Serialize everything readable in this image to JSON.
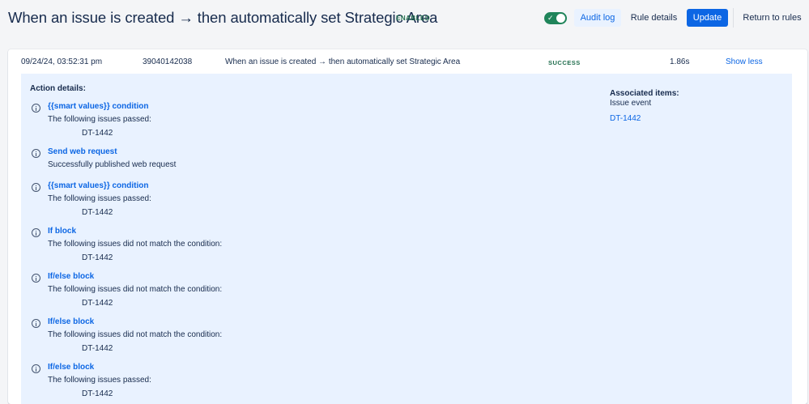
{
  "header": {
    "title": "When an issue is created → then automatically set Strategic Area",
    "status_badge": "ENABLED",
    "toggle_check": "✓",
    "audit_log_label": "Audit log",
    "rule_details_label": "Rule details",
    "update_label": "Update",
    "return_label": "Return to rules"
  },
  "log_entry": {
    "timestamp": "09/24/24, 03:52:31 pm",
    "id": "39040142038",
    "rule_name": "When an issue is created → then automatically set Strategic Area",
    "status": "SUCCESS",
    "duration": "1.86s",
    "show_less_label": "Show less"
  },
  "details": {
    "heading": "Action details:",
    "actions": [
      {
        "title": "{{smart values}} condition",
        "description": "The following issues passed:",
        "issue": "DT-1442"
      },
      {
        "title": "Send web request",
        "description": "Successfully published web request",
        "issue": ""
      },
      {
        "title": "{{smart values}} condition",
        "description": "The following issues passed:",
        "issue": "DT-1442"
      },
      {
        "title": "If block",
        "description": "The following issues did not match the condition:",
        "issue": "DT-1442"
      },
      {
        "title": "If/else block",
        "description": "The following issues did not match the condition:",
        "issue": "DT-1442"
      },
      {
        "title": "If/else block",
        "description": "The following issues did not match the condition:",
        "issue": "DT-1442"
      },
      {
        "title": "If/else block",
        "description": "The following issues passed:",
        "issue": "DT-1442"
      }
    ],
    "associated": {
      "title": "Associated items:",
      "subtitle": "Issue event",
      "link": "DT-1442"
    }
  },
  "colors": {
    "accent": "#0c66e4",
    "success": "#216e4e",
    "toggle_on": "#1f845a",
    "details_bg": "#e9f2ff"
  }
}
